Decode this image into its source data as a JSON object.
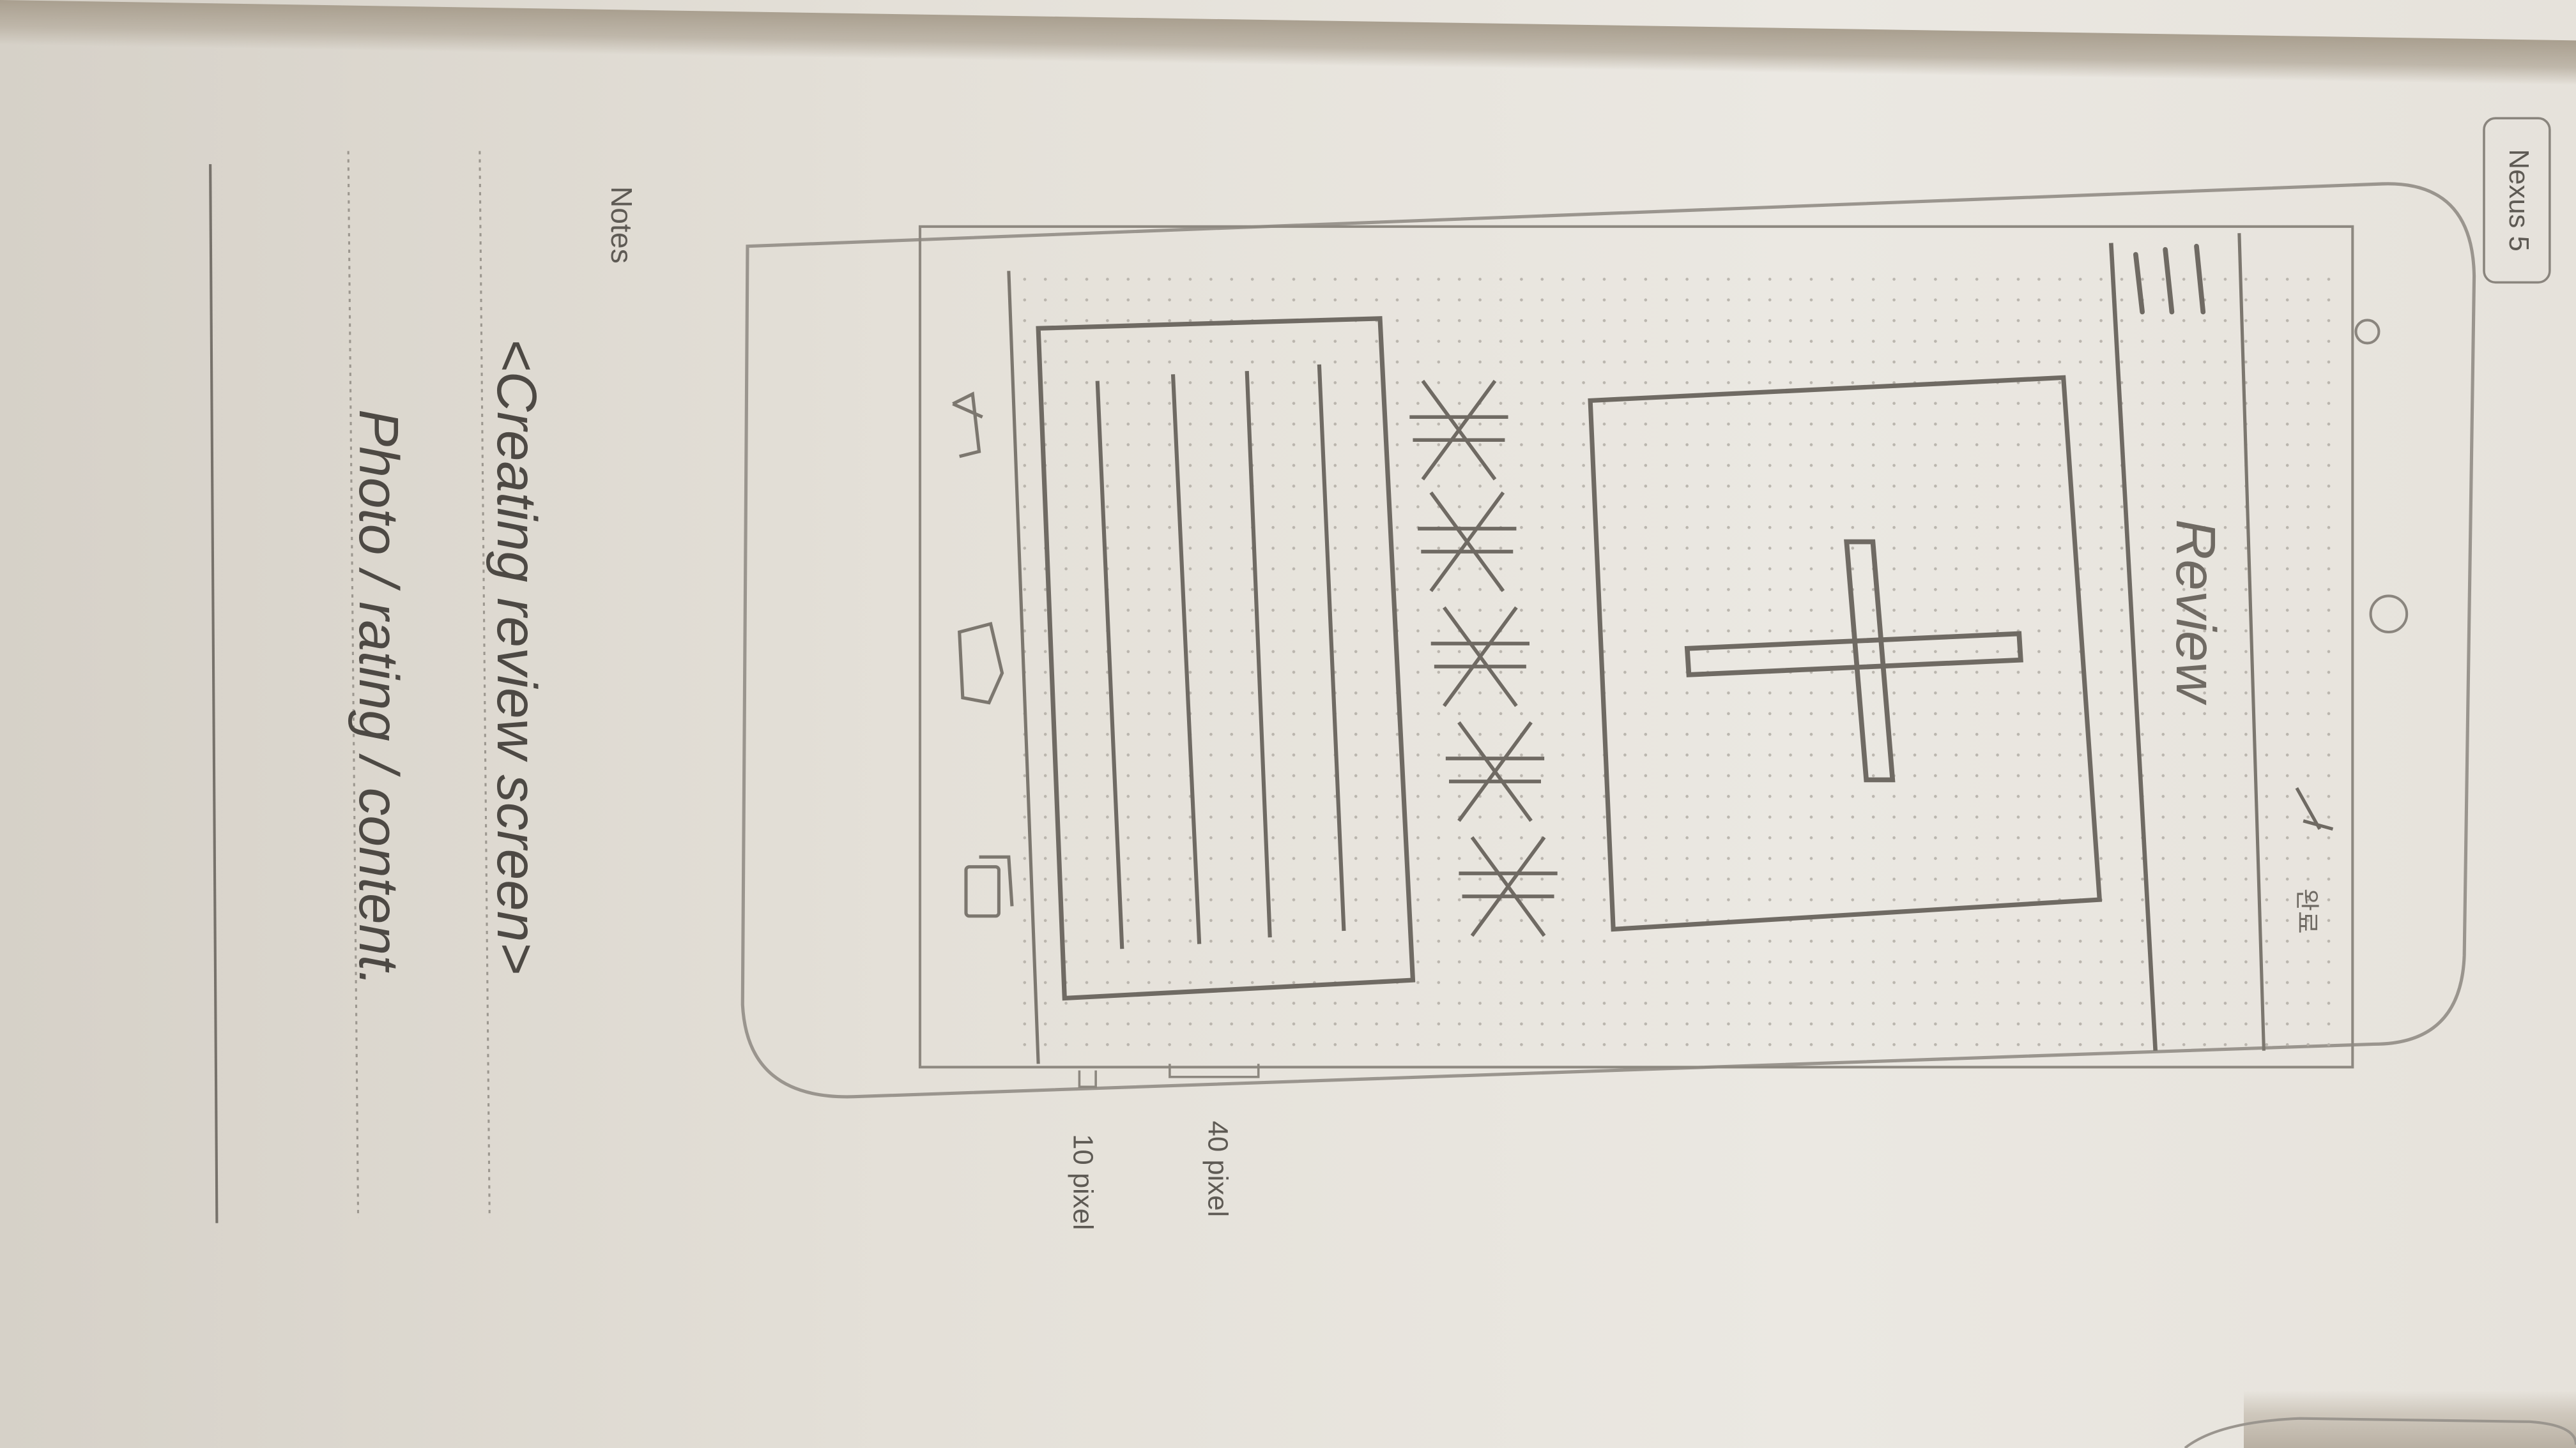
{
  "device": {
    "label": "Nexus 5"
  },
  "screen": {
    "app_bar": {
      "title": "Review",
      "action_text": "완료"
    },
    "rating": {
      "value": 5,
      "max": 5
    }
  },
  "notes": {
    "heading": "Notes",
    "line1": "<Creating review screen>",
    "line2": "Photo / rating / content."
  },
  "dimensions": {
    "top_bar": "40 pixel",
    "status_bar": "10 pixel"
  },
  "colors": {
    "pencil": "#6f6a63",
    "paper": "#e9e6e0",
    "guide": "#8c877f"
  },
  "icons": [
    "menu-icon",
    "add-photo-icon",
    "star-icon",
    "back-nav-icon",
    "home-nav-icon",
    "recents-nav-icon",
    "camera-icon",
    "sensor-icon"
  ]
}
